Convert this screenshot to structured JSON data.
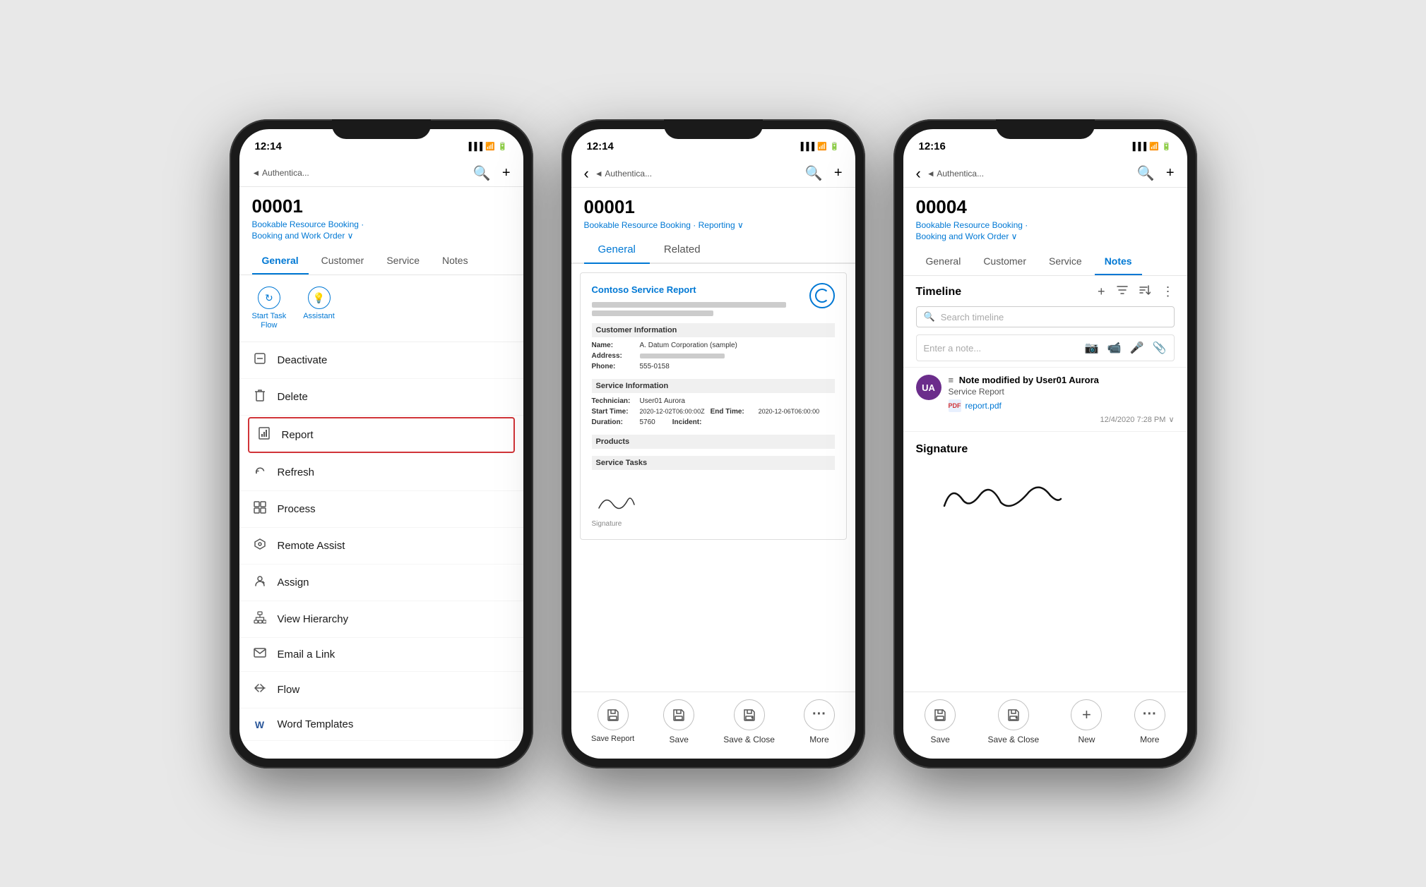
{
  "phones": [
    {
      "id": "phone1",
      "time": "12:14",
      "breadcrumb": "◄ Authentica...",
      "record_id": "00001",
      "subtitle_line1": "Bookable Resource Booking ·",
      "subtitle_line2": "Booking and Work Order ∨",
      "tabs": [
        "General",
        "Customer",
        "Service",
        "Notes"
      ],
      "active_tab": "General",
      "commands": [
        {
          "icon": "↻",
          "label": "Start Task\nFlow"
        },
        {
          "icon": "💡",
          "label": "Assistant"
        }
      ],
      "menu_items": [
        {
          "icon": "🔒",
          "label": "Deactivate",
          "highlighted": false
        },
        {
          "icon": "🗑",
          "label": "Delete",
          "highlighted": false
        },
        {
          "icon": "📊",
          "label": "Report",
          "highlighted": true
        },
        {
          "icon": "↺",
          "label": "Refresh",
          "highlighted": false
        },
        {
          "icon": "⊞",
          "label": "Process",
          "highlighted": false
        },
        {
          "icon": "⬡",
          "label": "Remote Assist",
          "highlighted": false
        },
        {
          "icon": "👤",
          "label": "Assign",
          "highlighted": false
        },
        {
          "icon": "⊕",
          "label": "View Hierarchy",
          "highlighted": false
        },
        {
          "icon": "✉",
          "label": "Email a Link",
          "highlighted": false
        },
        {
          "icon": "≫",
          "label": "Flow",
          "highlighted": false
        },
        {
          "icon": "W",
          "label": "Word Templates",
          "highlighted": false
        }
      ]
    },
    {
      "id": "phone2",
      "time": "12:14",
      "breadcrumb": "◄ Authentica...",
      "record_id": "00001",
      "subtitle_line1": "Bookable Resource Booking ·",
      "subtitle_reporting": "Reporting ∨",
      "tabs": [
        "General",
        "Related"
      ],
      "active_tab": "General",
      "report": {
        "title": "Contoso Service Report",
        "customer_section": "Customer Information",
        "name_label": "Name:",
        "name_value": "A. Datum Corporation (sample)",
        "address_label": "Address:",
        "phone_label": "Phone:",
        "phone_value": "555-0158",
        "service_section": "Service Information",
        "technician_label": "Technician:",
        "technician_value": "User01 Aurora",
        "start_label": "Start Time:",
        "start_value": "2020-12-02T06:00:00Z",
        "end_label": "End Time:",
        "end_value": "2020-12-06T06:00:00",
        "duration_label": "Duration:",
        "duration_value": "5760",
        "incident_label": "Incident:",
        "products_section": "Products",
        "tasks_section": "Service Tasks",
        "signature_label": "Signature"
      },
      "bottom_actions": [
        {
          "icon": "💾",
          "label": "Save Report"
        },
        {
          "icon": "💾",
          "label": "Save"
        },
        {
          "icon": "💾",
          "label": "Save & Close"
        },
        {
          "icon": "•••",
          "label": "More"
        }
      ]
    },
    {
      "id": "phone3",
      "time": "12:16",
      "breadcrumb": "◄ Authentica...",
      "record_id": "00004",
      "subtitle_line1": "Bookable Resource Booking ·",
      "subtitle_line2": "Booking and Work Order ∨",
      "tabs": [
        "General",
        "Customer",
        "Service",
        "Notes"
      ],
      "active_tab": "Notes",
      "timeline": {
        "title": "Timeline",
        "search_placeholder": "Search timeline",
        "note_placeholder": "Enter a note...",
        "note": {
          "avatar_initials": "UA",
          "title": "Note modified by User01 Aurora",
          "subtitle": "Service Report",
          "link_text": "report.pdf",
          "timestamp": "12/4/2020 7:28 PM"
        }
      },
      "signature_section": {
        "title": "Signature"
      },
      "bottom_actions": [
        {
          "icon": "💾",
          "label": "Save"
        },
        {
          "icon": "💾",
          "label": "Save & Close"
        },
        {
          "icon": "+",
          "label": "New"
        },
        {
          "icon": "•••",
          "label": "More"
        }
      ]
    }
  ]
}
